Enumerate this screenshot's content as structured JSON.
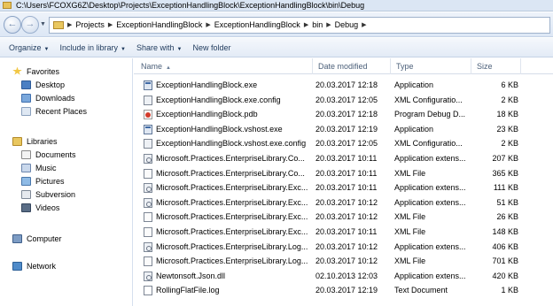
{
  "window": {
    "title": "C:\\Users\\FCOXG6Z\\Desktop\\Projects\\ExceptionHandlingBlock\\ExceptionHandlingBlock\\bin\\Debug"
  },
  "address": {
    "crumbs": [
      "Projects",
      "ExceptionHandlingBlock",
      "ExceptionHandlingBlock",
      "bin",
      "Debug"
    ]
  },
  "toolbar": {
    "organize": "Organize",
    "include_in_library": "Include in library",
    "share_with": "Share with",
    "new_folder": "New folder"
  },
  "nav": {
    "favorites": "Favorites",
    "desktop": "Desktop",
    "downloads": "Downloads",
    "recent_places": "Recent Places",
    "libraries": "Libraries",
    "documents": "Documents",
    "music": "Music",
    "pictures": "Pictures",
    "subversion": "Subversion",
    "videos": "Videos",
    "computer": "Computer",
    "network": "Network"
  },
  "columns": {
    "name": "Name",
    "date": "Date modified",
    "type": "Type",
    "size": "Size"
  },
  "files": [
    {
      "name": "ExceptionHandlingBlock.exe",
      "date": "20.03.2017 12:18",
      "type": "Application",
      "size": "6 KB",
      "icon": "exe-icon"
    },
    {
      "name": "ExceptionHandlingBlock.exe.config",
      "date": "20.03.2017 12:05",
      "type": "XML Configuratio...",
      "size": "2 KB",
      "icon": "config-icon"
    },
    {
      "name": "ExceptionHandlingBlock.pdb",
      "date": "20.03.2017 12:18",
      "type": "Program Debug D...",
      "size": "18 KB",
      "icon": "pdb-icon"
    },
    {
      "name": "ExceptionHandlingBlock.vshost.exe",
      "date": "20.03.2017 12:19",
      "type": "Application",
      "size": "23 KB",
      "icon": "exe-icon"
    },
    {
      "name": "ExceptionHandlingBlock.vshost.exe.config",
      "date": "20.03.2017 12:05",
      "type": "XML Configuratio...",
      "size": "2 KB",
      "icon": "config-icon"
    },
    {
      "name": "Microsoft.Practices.EnterpriseLibrary.Co...",
      "date": "20.03.2017 10:11",
      "type": "Application extens...",
      "size": "207 KB",
      "icon": "dll-icon"
    },
    {
      "name": "Microsoft.Practices.EnterpriseLibrary.Co...",
      "date": "20.03.2017 10:11",
      "type": "XML File",
      "size": "365 KB",
      "icon": "xml-icon"
    },
    {
      "name": "Microsoft.Practices.EnterpriseLibrary.Exc...",
      "date": "20.03.2017 10:11",
      "type": "Application extens...",
      "size": "111 KB",
      "icon": "dll-icon"
    },
    {
      "name": "Microsoft.Practices.EnterpriseLibrary.Exc...",
      "date": "20.03.2017 10:12",
      "type": "Application extens...",
      "size": "51 KB",
      "icon": "dll-icon"
    },
    {
      "name": "Microsoft.Practices.EnterpriseLibrary.Exc...",
      "date": "20.03.2017 10:12",
      "type": "XML File",
      "size": "26 KB",
      "icon": "xml-icon"
    },
    {
      "name": "Microsoft.Practices.EnterpriseLibrary.Exc...",
      "date": "20.03.2017 10:11",
      "type": "XML File",
      "size": "148 KB",
      "icon": "xml-icon"
    },
    {
      "name": "Microsoft.Practices.EnterpriseLibrary.Log...",
      "date": "20.03.2017 10:12",
      "type": "Application extens...",
      "size": "406 KB",
      "icon": "dll-icon"
    },
    {
      "name": "Microsoft.Practices.EnterpriseLibrary.Log...",
      "date": "20.03.2017 10:12",
      "type": "XML File",
      "size": "701 KB",
      "icon": "xml-icon"
    },
    {
      "name": "Newtonsoft.Json.dll",
      "date": "02.10.2013 12:03",
      "type": "Application extens...",
      "size": "420 KB",
      "icon": "dll-icon"
    },
    {
      "name": "RollingFlatFile.log",
      "date": "20.03.2017 12:19",
      "type": "Text Document",
      "size": "1 KB",
      "icon": "log-icon"
    }
  ],
  "colors": {
    "highlight": "#fbff4a",
    "toolbar_text": "#1e395b",
    "header_text": "#4c607a"
  }
}
